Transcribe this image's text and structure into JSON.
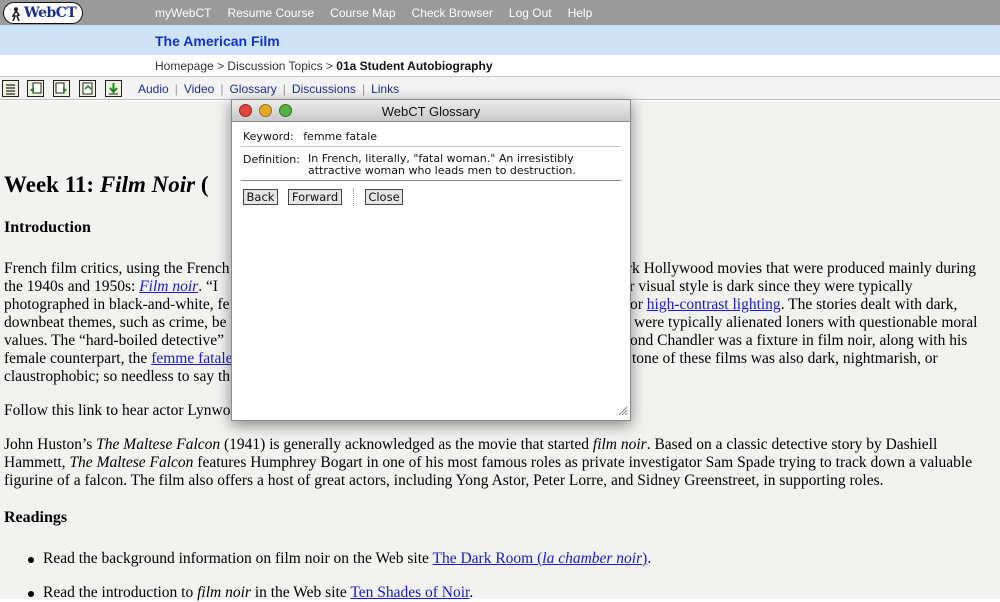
{
  "brand": {
    "logo_text": "WebCT"
  },
  "topnav": [
    "myWebCT",
    "Resume Course",
    "Course Map",
    "Check Browser",
    "Log Out",
    "Help"
  ],
  "course": {
    "title": "The American Film"
  },
  "breadcrumb": {
    "items": [
      "Homepage",
      "Discussion Topics"
    ],
    "separator": ">",
    "current": "01a Student Autobiography"
  },
  "toolbar": {
    "icons": [
      "list-icon",
      "page-back-icon",
      "page-forward-icon",
      "page-icon",
      "download-icon"
    ],
    "links": [
      "Audio",
      "Video",
      "Glossary",
      "Discussions",
      "Links"
    ]
  },
  "content": {
    "heading_prefix": "Week 11:",
    "heading_italic": "Film Noir",
    "heading_suffix": "(",
    "intro_heading": "Introduction",
    "intro_para": {
      "l1_a": "French film critics, using the French",
      "l1_b": "ark Hollywood movies that were produced mainly during",
      "l2_a": "the 1940s and 1950s:",
      "l2_link": "Film noir",
      "l2_b": ".  “I",
      "l2_c": "ir visual style is dark since they were typically",
      "l3_a": "photographed in black-and-white, fe",
      "l3_b": "or",
      "l3_link": "high-contrast lighting",
      "l3_c": ".  The stories dealt with dark,",
      "l4_a": "downbeat themes, such as crime, be",
      "l4_b": "were typically alienated loners with questionable moral",
      "l5_a": "values.  The “hard-boiled detective”",
      "l5_b": "ond Chandler was a fixture in film noir, along with his",
      "l6_a": "female counterpart, the",
      "l6_link": "femme fatale",
      "l6_b": "tone of these films was also dark, nightmarish, or",
      "l7_a": "claustrophobic; so needless to say th"
    },
    "follow_para": "Follow this link to hear actor Lynwo",
    "huston_para": {
      "l1_a": "John Huston’s",
      "l1_i": "The Maltese Falcon",
      "l1_b": "(1941) is generally acknowledged as the movie that started",
      "l1_i2": "film noir",
      "l1_c": ".  Based on a classic detective story by Dashiell",
      "l2_a": "Hammett,",
      "l2_i": "The Maltese Falcon",
      "l2_b": "features Humphrey Bogart in one of his most famous roles as private investigator Sam Spade trying to track down a valuable",
      "l3": "figurine of a falcon.  The film also offers a host of great actors, including Yong Astor, Peter Lorre, and Sidney Greenstreet, in supporting roles."
    },
    "readings_heading": "Readings",
    "readings": [
      {
        "a": "Read the background information on film noir on the Web site",
        "link": "The Dark Room (",
        "link_i": "la chamber noir",
        "link_end": ")",
        "end": "."
      },
      {
        "a": "Read the introduction to",
        "i": "film noir",
        "b": "in the Web site",
        "link": "Ten Shades of Noir",
        "end": "."
      }
    ]
  },
  "glossary": {
    "window_title": "WebCT Glossary",
    "keyword_label": "Keyword:",
    "keyword_value": "femme fatale",
    "definition_label": "Definition:",
    "definition_value": "In French, literally, \"fatal woman.\" An irresistibly attractive woman who leads men to destruction.",
    "buttons": {
      "back": "Back",
      "forward": "Forward",
      "close": "Close"
    }
  },
  "colors": {
    "topbar": "#9a9a9a",
    "course_bar": "#cfe3f8",
    "course_title": "#1134c8",
    "link": "#1a1acc"
  }
}
